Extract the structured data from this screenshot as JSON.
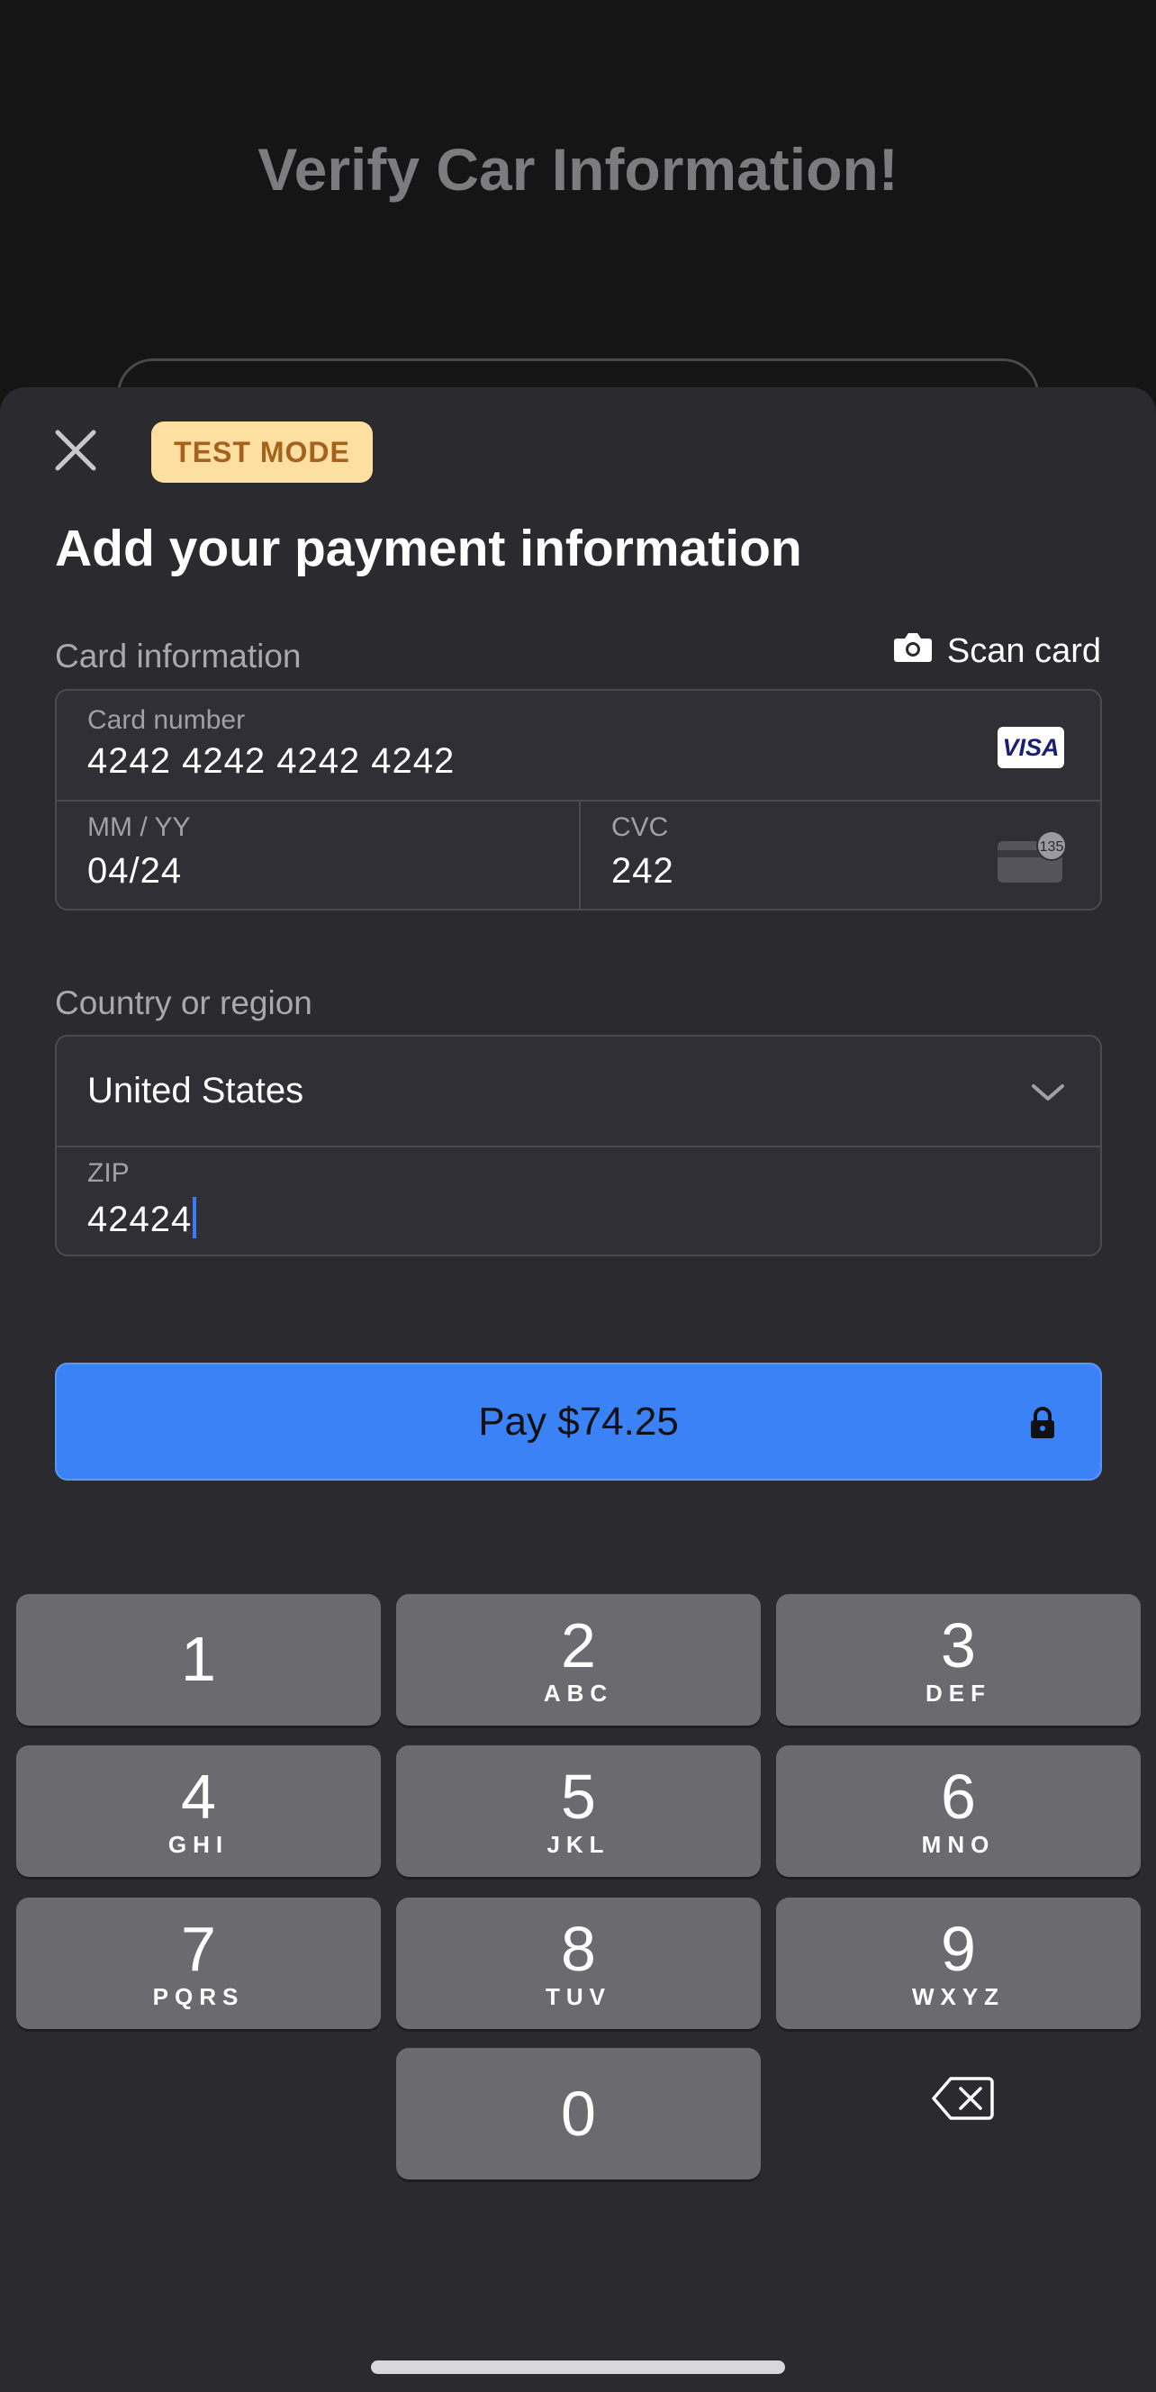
{
  "background": {
    "title": "Verify Car Information!"
  },
  "sheet": {
    "badge": "TEST MODE",
    "title": "Add your payment information",
    "card_section_label": "Card information",
    "scan_card_label": "Scan card",
    "card_number_label": "Card number",
    "card_number_value": "4242 4242 4242 4242",
    "card_brand": "VISA",
    "expiry_label": "MM / YY",
    "expiry_value": "04/24",
    "cvc_label": "CVC",
    "cvc_value": "242",
    "cvc_icon_text": "135",
    "country_section_label": "Country or region",
    "country_value": "United States",
    "zip_label": "ZIP",
    "zip_value": "42424",
    "pay_label": "Pay $74.25"
  },
  "keypad": {
    "keys": [
      {
        "num": "1",
        "letters": ""
      },
      {
        "num": "2",
        "letters": "ABC"
      },
      {
        "num": "3",
        "letters": "DEF"
      },
      {
        "num": "4",
        "letters": "GHI"
      },
      {
        "num": "5",
        "letters": "JKL"
      },
      {
        "num": "6",
        "letters": "MNO"
      },
      {
        "num": "7",
        "letters": "PQRS"
      },
      {
        "num": "8",
        "letters": "TUV"
      },
      {
        "num": "9",
        "letters": "WXYZ"
      },
      {
        "num": "0",
        "letters": ""
      }
    ]
  },
  "colors": {
    "accent": "#3b82f6",
    "badge_bg": "#fde0a1",
    "badge_text": "#a6621c",
    "sheet_bg": "#2b2a2f",
    "key_bg": "#6b6a6f"
  },
  "icons": [
    "close-icon",
    "camera-icon",
    "visa-logo",
    "cvc-card-icon",
    "chevron-down-icon",
    "lock-icon",
    "backspace-icon"
  ]
}
